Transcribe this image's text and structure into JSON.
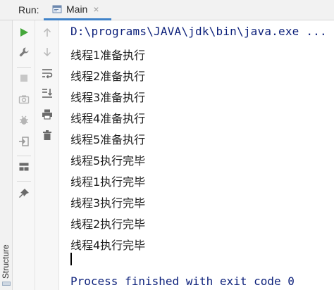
{
  "header": {
    "run_label": "Run:",
    "tab": {
      "label": "Main",
      "close": "×",
      "icon": "run-config-icon"
    }
  },
  "structure": {
    "label": "Structure"
  },
  "toolbar": {
    "left": [
      "run-icon",
      "wrench-icon",
      "stop-icon",
      "camera-icon",
      "bug-icon",
      "exit-icon",
      "layout-icon",
      "pin-icon"
    ],
    "right": [
      "up-arrow-icon",
      "down-arrow-icon",
      "soft-wrap-icon",
      "scroll-to-end-icon",
      "print-icon",
      "trash-icon"
    ]
  },
  "console": {
    "command": "D:\\programs\\JAVA\\jdk\\bin\\java.exe ...",
    "lines": [
      "线程1准备执行",
      "线程2准备执行",
      "线程3准备执行",
      "线程4准备执行",
      "线程5准备执行",
      "线程5执行完毕",
      "线程1执行完毕",
      "线程3执行完毕",
      "线程2执行完毕",
      "线程4执行完毕"
    ],
    "exit_message": "Process finished with exit code 0"
  },
  "colors": {
    "accent": "#4083c9",
    "command_text": "#0b1f7a",
    "run_green": "#45a73b",
    "icon_gray": "#7a7a7a"
  }
}
